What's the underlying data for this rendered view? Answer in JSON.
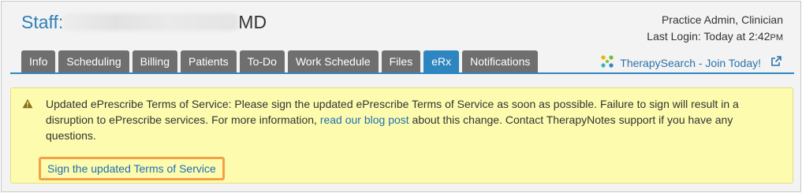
{
  "header": {
    "staff_label": "Staff:",
    "staff_suffix": "MD",
    "role": "Practice Admin, Clinician",
    "last_login_prefix": "Last Login: Today at 2:42",
    "last_login_ampm": "PM"
  },
  "tabs": [
    {
      "label": "Info"
    },
    {
      "label": "Scheduling"
    },
    {
      "label": "Billing"
    },
    {
      "label": "Patients"
    },
    {
      "label": "To-Do"
    },
    {
      "label": "Work Schedule"
    },
    {
      "label": "Files"
    },
    {
      "label": "eRx",
      "active": true
    },
    {
      "label": "Notifications"
    }
  ],
  "therapysearch": {
    "label": "TherapySearch - Join Today!",
    "icon": "therapysearch-logo-icon",
    "external_icon": "external-link-icon"
  },
  "alert": {
    "text_1": "Updated ePrescribe Terms of Service: Please sign the updated ePrescribe Terms of Service as soon as possible. Failure to sign will result in a disruption to ePrescribe services. For more information, ",
    "link_text": "read our blog post",
    "text_2": " about this change. Contact TherapyNotes support if you have any questions.",
    "sign_link": "Sign the updated Terms of Service",
    "icon": "warning-icon"
  },
  "colors": {
    "accent": "#2e86c1",
    "tab": "#6f6f6f",
    "alert_bg": "#fdfbae",
    "highlight": "#f1a247"
  }
}
